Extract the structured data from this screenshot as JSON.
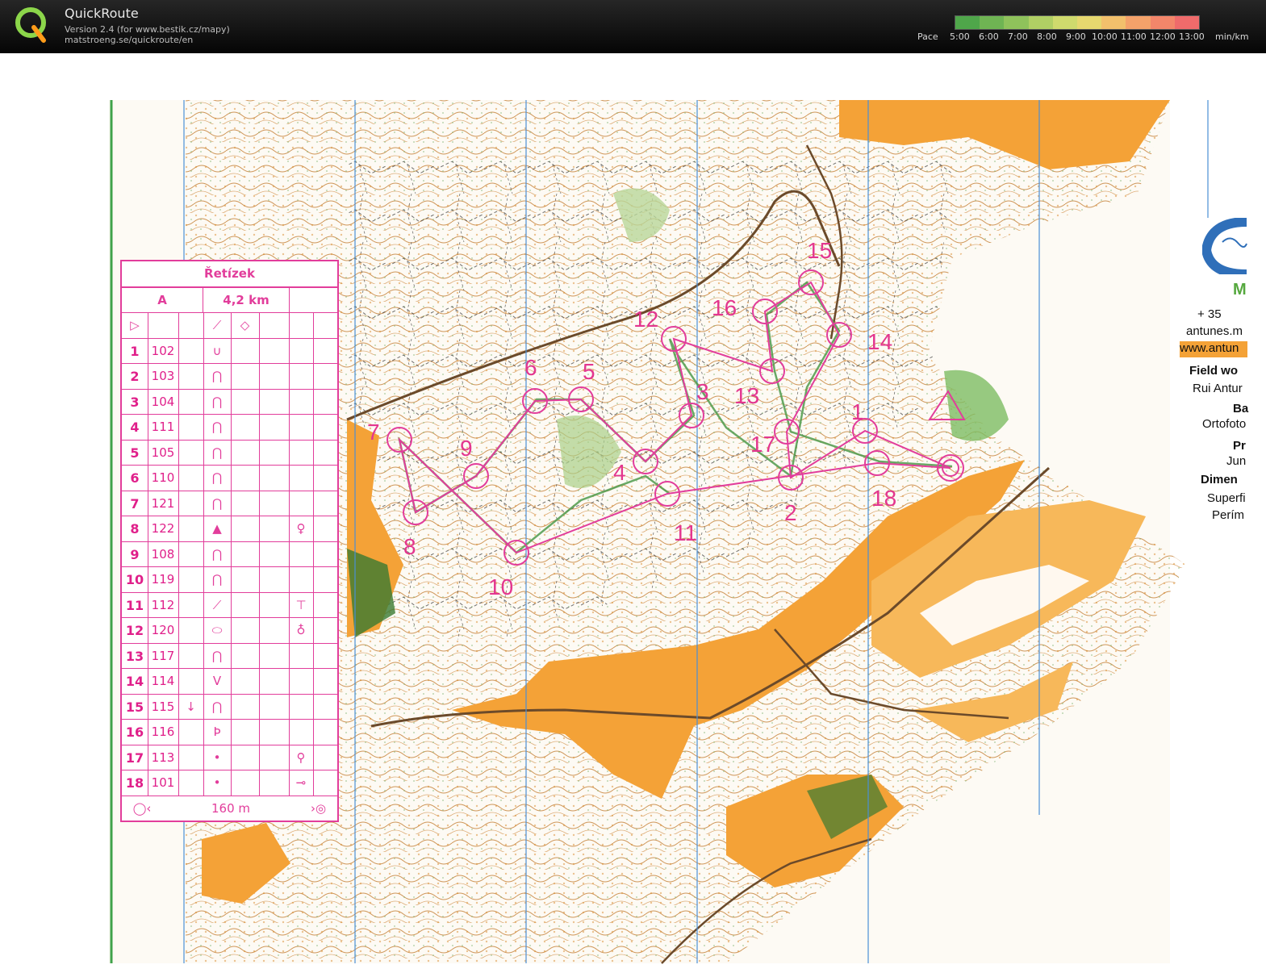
{
  "app": {
    "title": "QuickRoute",
    "version_line": "Version 2.4  (for www.bestik.cz/mapy)",
    "url_line": "matstroeng.se/quickroute/en"
  },
  "pace_scale": {
    "label": "Pace",
    "ticks": [
      "5:00",
      "6:00",
      "7:00",
      "8:00",
      "9:00",
      "10:00",
      "11:00",
      "12:00",
      "13:00"
    ],
    "unit": "min/km",
    "colors": [
      "#4fa64a",
      "#6fb453",
      "#8fc25b",
      "#b0cf64",
      "#cfda6d",
      "#e6d86f",
      "#f2c06c",
      "#f4a26a",
      "#f3866a",
      "#ef6b6b"
    ]
  },
  "course_box": {
    "title": "Řetízek",
    "course": "A",
    "length": "4,2 km",
    "rows": [
      {
        "num": "1",
        "code": "102",
        "symbol": "∪",
        "extra": ""
      },
      {
        "num": "2",
        "code": "103",
        "symbol": "⋂",
        "extra": ""
      },
      {
        "num": "3",
        "code": "104",
        "symbol": "⋂",
        "extra": ""
      },
      {
        "num": "4",
        "code": "111",
        "symbol": "⋂",
        "extra": ""
      },
      {
        "num": "5",
        "code": "105",
        "symbol": "⋂",
        "extra": ""
      },
      {
        "num": "6",
        "code": "110",
        "symbol": "⋂",
        "extra": ""
      },
      {
        "num": "7",
        "code": "121",
        "symbol": "⋂",
        "extra": ""
      },
      {
        "num": "8",
        "code": "122",
        "symbol": "▲",
        "extra": "♀"
      },
      {
        "num": "9",
        "code": "108",
        "symbol": "⋂",
        "extra": ""
      },
      {
        "num": "10",
        "code": "119",
        "symbol": "⋂",
        "extra": ""
      },
      {
        "num": "11",
        "code": "112",
        "symbol": "⟋",
        "extra": "⊤"
      },
      {
        "num": "12",
        "code": "120",
        "symbol": "⬭",
        "extra": "♁"
      },
      {
        "num": "13",
        "code": "117",
        "symbol": "⋂",
        "extra": ""
      },
      {
        "num": "14",
        "code": "114",
        "symbol": "V",
        "extra": ""
      },
      {
        "num": "15",
        "code": "115",
        "symbol": "⋂",
        "extra": "",
        "marker": "↓"
      },
      {
        "num": "16",
        "code": "116",
        "symbol": "Ϸ",
        "extra": ""
      },
      {
        "num": "17",
        "code": "113",
        "symbol": "•",
        "extra": "⚲"
      },
      {
        "num": "18",
        "code": "101",
        "symbol": "•",
        "extra": "⊸"
      }
    ],
    "finish_distance": "160 m"
  },
  "legend_right": {
    "phone": "+ 35",
    "web1": "antunes.m",
    "web2": "www.antun",
    "field_work": "Field wo",
    "field_name": "Rui Antur",
    "base": "Ba",
    "base_val": "Ortofoto",
    "pr": "Pr",
    "pr_val": "Jun",
    "dimen": "Dimen",
    "dim1": "Superfi",
    "dim2": "Perím",
    "logo_letter": "M"
  },
  "controls": [
    {
      "n": "1"
    },
    {
      "n": "2"
    },
    {
      "n": "3"
    },
    {
      "n": "4"
    },
    {
      "n": "5"
    },
    {
      "n": "6"
    },
    {
      "n": "7"
    },
    {
      "n": "8"
    },
    {
      "n": "9"
    },
    {
      "n": "10"
    },
    {
      "n": "11"
    },
    {
      "n": "12"
    },
    {
      "n": "13"
    },
    {
      "n": "14"
    },
    {
      "n": "15"
    },
    {
      "n": "16"
    },
    {
      "n": "17"
    },
    {
      "n": "18"
    }
  ],
  "colors": {
    "course": "#e23d9b",
    "open_land": "#f4a237",
    "route": "#4f9a4b"
  }
}
